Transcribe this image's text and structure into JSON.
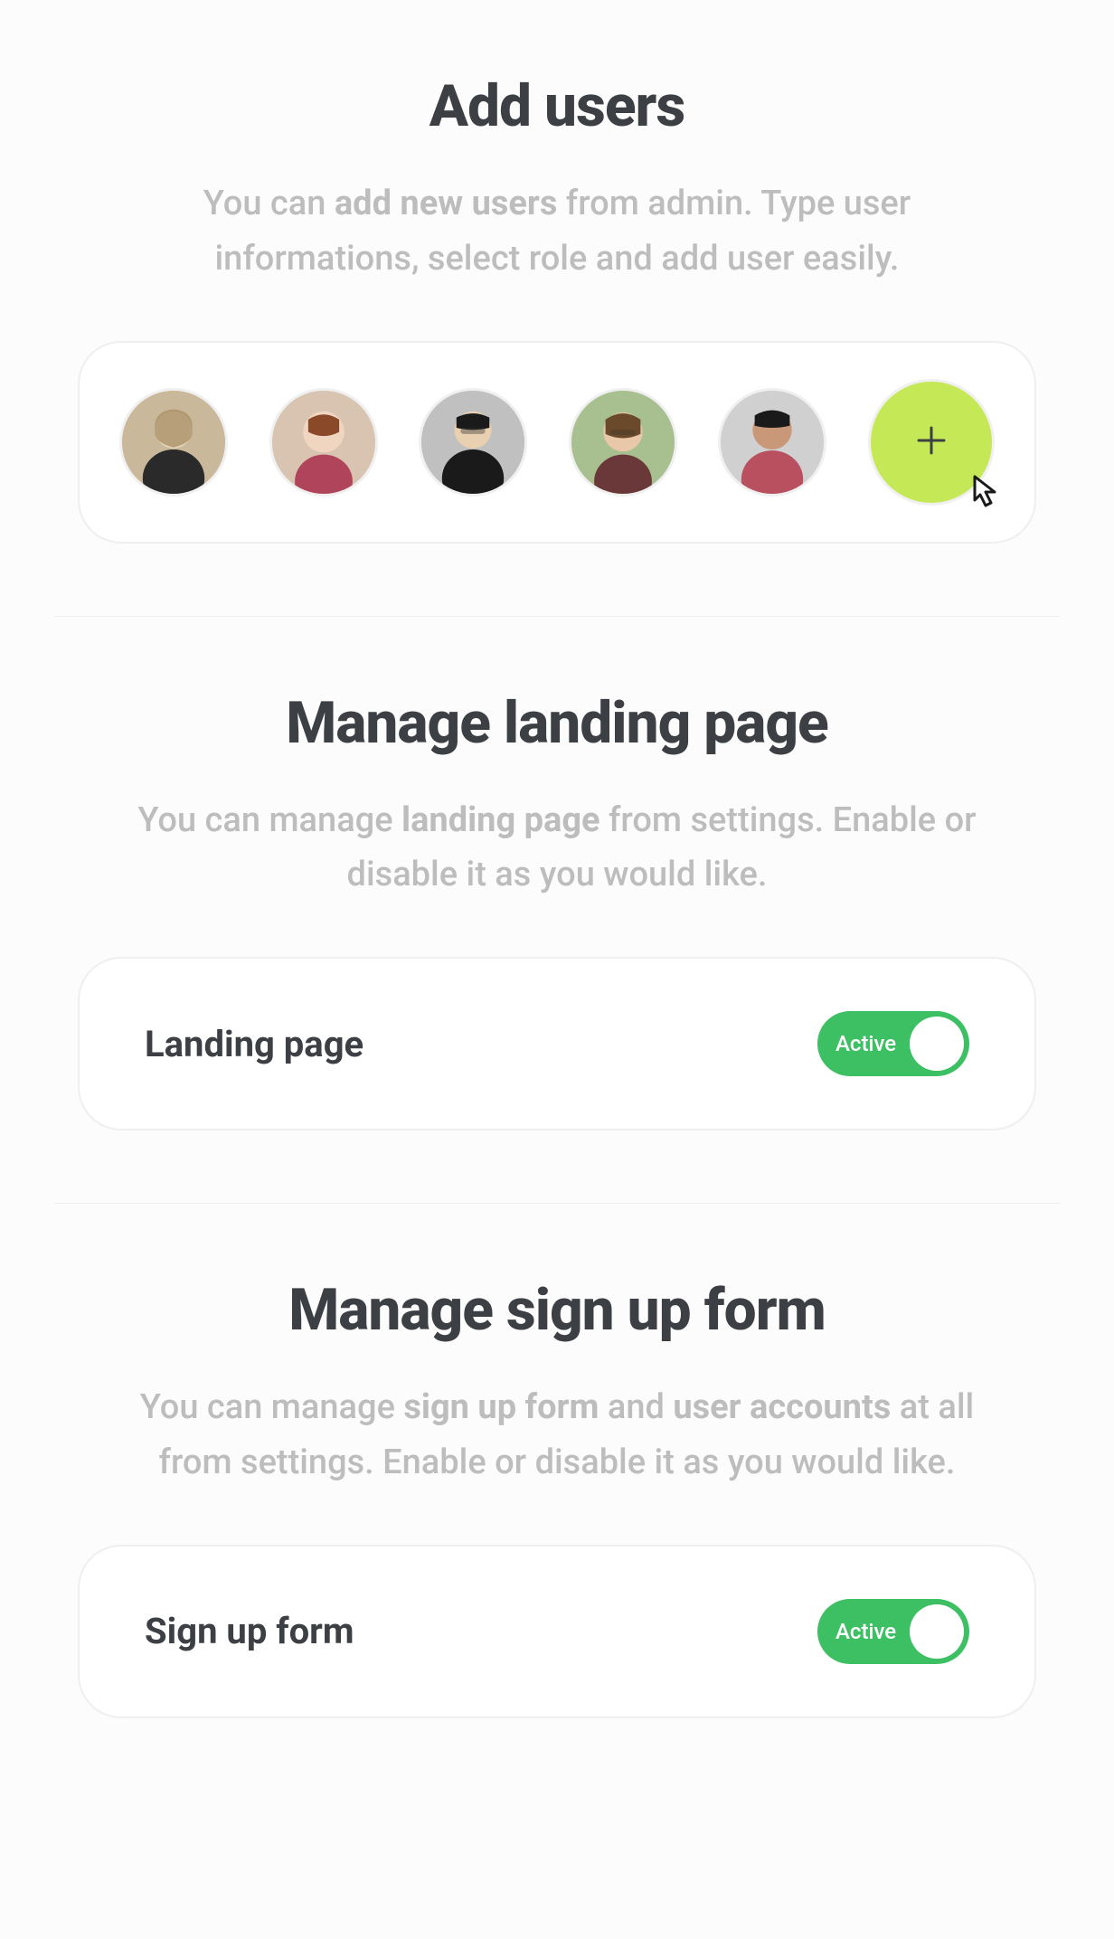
{
  "sections": {
    "add_users": {
      "title": "Add users",
      "desc_pre": "You can ",
      "desc_strong": "add new users",
      "desc_post": " from admin. Type user informations, select role and add user easily.",
      "avatars": [
        "user-1",
        "user-2",
        "user-3",
        "user-4",
        "user-5"
      ]
    },
    "landing_page": {
      "title": "Manage landing page",
      "desc_pre": "You can manage ",
      "desc_strong": "landing page",
      "desc_post": " from settings. Enable or disable it as you would like.",
      "toggle_label": "Landing page",
      "toggle_status": "Active"
    },
    "sign_up": {
      "title": "Manage sign up form",
      "desc_pre": "You can manage ",
      "desc_strong1": "sign up form",
      "desc_mid": " and ",
      "desc_strong2": "user accounts",
      "desc_post": " at all from settings. Enable or disable it as you would like.",
      "toggle_label": "Sign up form",
      "toggle_status": "Active"
    }
  },
  "colors": {
    "accent_green": "#c5e857",
    "toggle_green": "#3dc063",
    "heading": "#3c3f44",
    "muted": "#bdbdbd"
  }
}
